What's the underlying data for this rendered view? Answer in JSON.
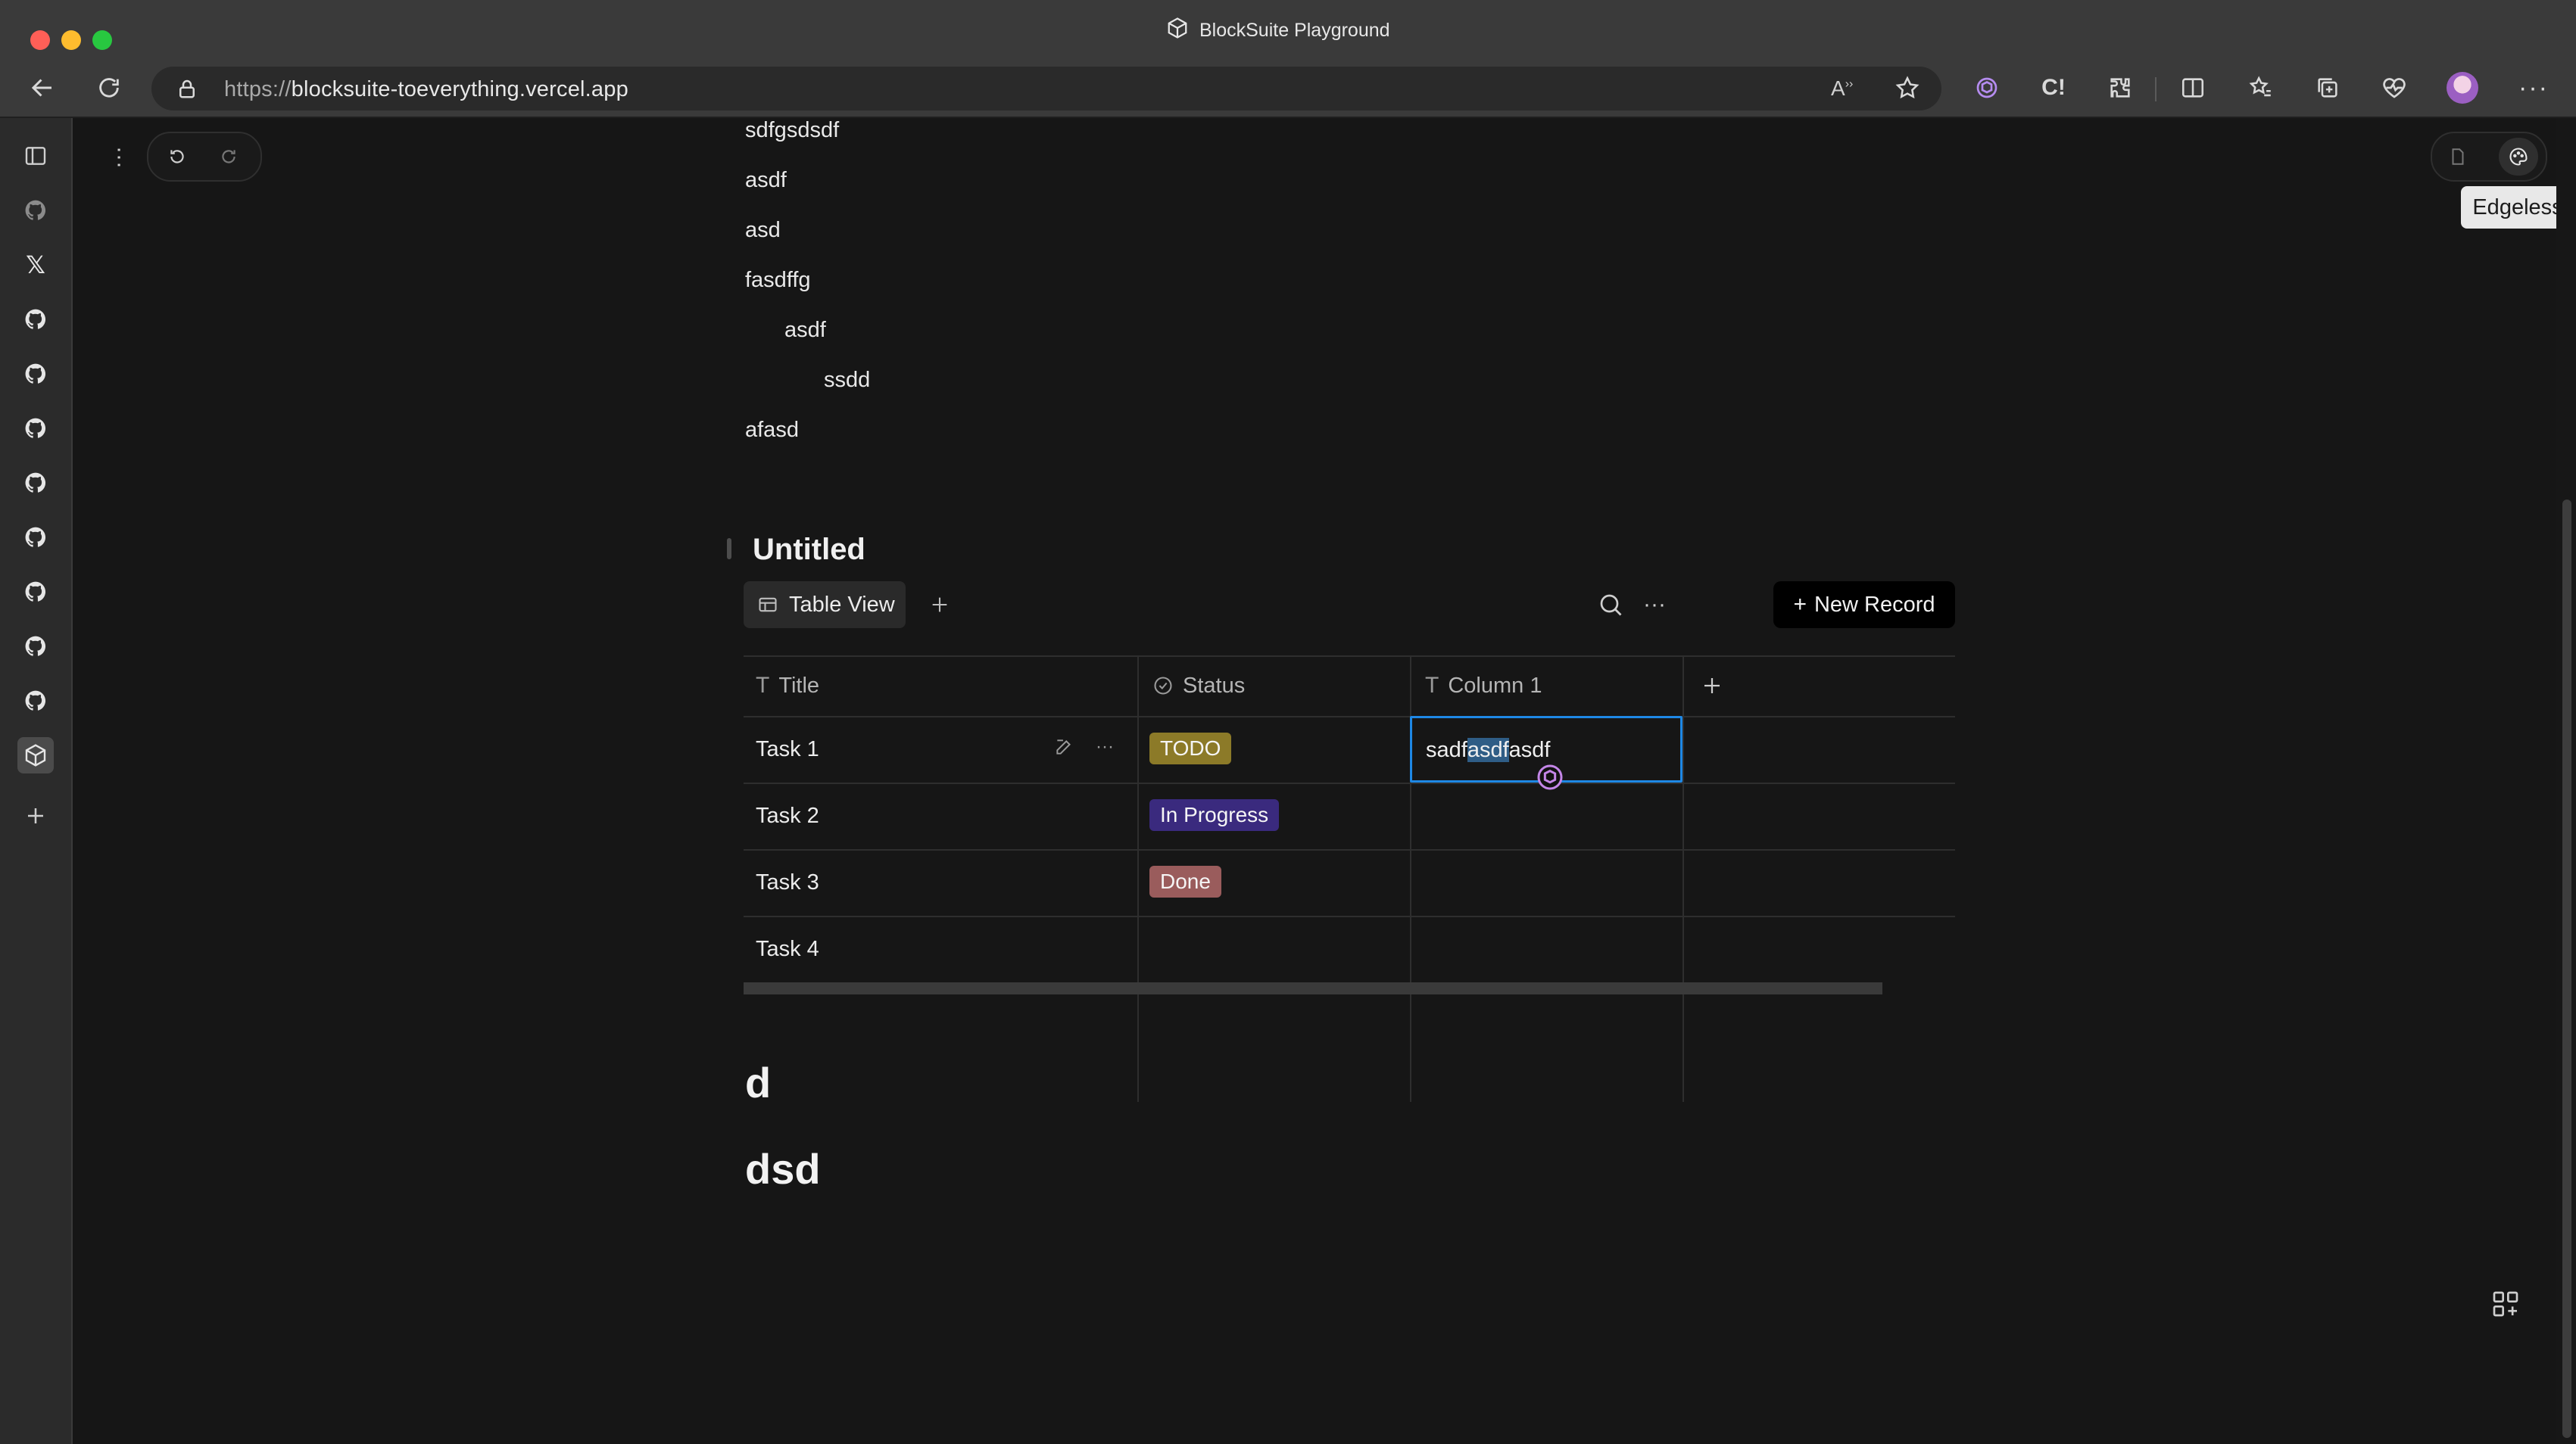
{
  "window": {
    "title": "BlockSuite Playground"
  },
  "browser": {
    "url_protocol": "https://",
    "url_host": "blocksuite-toeverything.vercel.app"
  },
  "sidebar": {
    "items": [
      {
        "icon": "panel-icon"
      },
      {
        "icon": "github-icon"
      },
      {
        "icon": "x-icon"
      },
      {
        "icon": "github-icon"
      },
      {
        "icon": "github-icon"
      },
      {
        "icon": "github-icon"
      },
      {
        "icon": "github-icon"
      },
      {
        "icon": "github-icon"
      },
      {
        "icon": "github-icon"
      },
      {
        "icon": "github-icon"
      },
      {
        "icon": "github-icon"
      },
      {
        "icon": "blocksuite-icon",
        "active": true
      },
      {
        "icon": "plus-icon"
      }
    ]
  },
  "editor": {
    "mode_tooltip": "Edgeless",
    "paragraphs": [
      {
        "text": "sdfgsdsdf",
        "indent": 0
      },
      {
        "text": "asdf",
        "indent": 0
      },
      {
        "text": "asd",
        "indent": 0
      },
      {
        "text": "fasdffg",
        "indent": 0
      },
      {
        "text": "asdf",
        "indent": 1
      },
      {
        "text": "ssdd",
        "indent": 2
      },
      {
        "text": "afasd",
        "indent": 0
      }
    ],
    "headings": [
      "d",
      "dsd"
    ]
  },
  "database": {
    "title": "Untitled",
    "view_tab": "Table View",
    "new_record": "New Record",
    "columns": [
      {
        "name": "Title",
        "type": "text"
      },
      {
        "name": "Status",
        "type": "select"
      },
      {
        "name": "Column 1",
        "type": "text"
      }
    ],
    "rows": [
      {
        "title": "Task 1",
        "status": "TODO",
        "status_color": "#8c7a28",
        "col1": "sadfasdfasdf"
      },
      {
        "title": "Task 2",
        "status": "In Progress",
        "status_color": "#3a2a7e",
        "col1": ""
      },
      {
        "title": "Task 3",
        "status": "Done",
        "status_color": "#9a5c5c",
        "col1": ""
      },
      {
        "title": "Task 4",
        "status": "",
        "status_color": "",
        "col1": ""
      }
    ],
    "selected_cell": {
      "before": "sadf",
      "highlight": "asdf",
      "after": "asdf"
    }
  },
  "colors": {
    "accent": "#1e88e5",
    "background": "#161616"
  }
}
